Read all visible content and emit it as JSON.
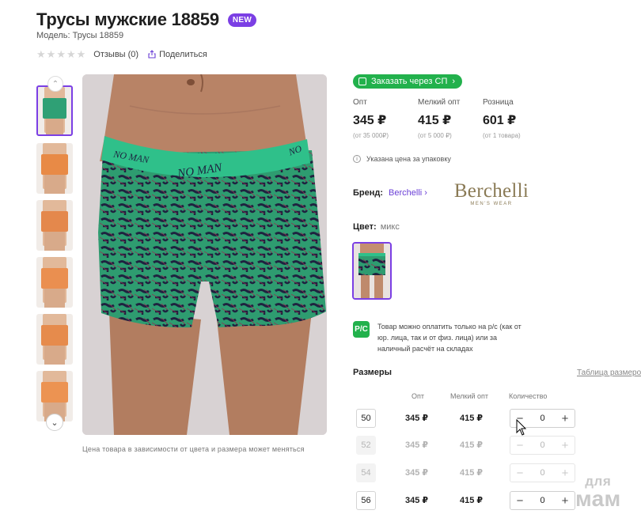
{
  "product": {
    "title": "Трусы мужские 18859",
    "badge": "NEW",
    "model": "Модель: Трусы 18859",
    "reviews": "Отзывы (0)",
    "share": "Поделиться",
    "stars_filled": 0,
    "stars_total": 5
  },
  "gallery": {
    "note": "Цена товара в зависимости от цвета и размера может меняться",
    "print_text": "NO MAN",
    "colors": {
      "accent": "#7b3fe4",
      "green_fabric": "#2fa075",
      "orange_fabric": "#e88a46"
    }
  },
  "order": {
    "label": "Заказать через СП"
  },
  "prices": [
    {
      "label": "Опт",
      "value": "345 ₽",
      "sub": "(от 35 000₽)"
    },
    {
      "label": "Мелкий опт",
      "value": "415 ₽",
      "sub": "(от 5 000 ₽)"
    },
    {
      "label": "Розница",
      "value": "601 ₽",
      "sub": "(от 1 товара)"
    }
  ],
  "pack_note": "Указана цена за упаковку",
  "brand": {
    "label": "Бренд:",
    "name": "Berchelli",
    "logo_text": "Berchelli",
    "logo_sub": "MEN'S WEAR"
  },
  "color": {
    "label": "Цвет:",
    "value": "микс"
  },
  "payment": {
    "icon": "Р/С",
    "text": "Товар можно оплатить только на р/с (как от юр. лица, так и от физ. лица) или за наличный расчёт на складах"
  },
  "sizes": {
    "title": "Размеры",
    "table_link": "Таблица размеров",
    "headers": {
      "opt": "Опт",
      "small": "Мелкий опт",
      "qty": "Количество"
    },
    "rows": [
      {
        "size": "50",
        "opt": "345 ₽",
        "small": "415 ₽",
        "qty": "0",
        "available": true
      },
      {
        "size": "52",
        "opt": "345 ₽",
        "small": "415 ₽",
        "qty": "0",
        "available": false
      },
      {
        "size": "54",
        "opt": "345 ₽",
        "small": "415 ₽",
        "qty": "0",
        "available": false
      },
      {
        "size": "56",
        "opt": "345 ₽",
        "small": "415 ₽",
        "qty": "0",
        "available": true
      }
    ]
  },
  "watermark": {
    "top": "для",
    "bottom": "мам"
  },
  "icons": [
    "star-icon",
    "share-icon",
    "chevron-up-icon",
    "chevron-down-icon",
    "cart-icon",
    "info-icon",
    "chevron-right-icon",
    "minus-icon",
    "plus-icon",
    "cursor-icon"
  ]
}
